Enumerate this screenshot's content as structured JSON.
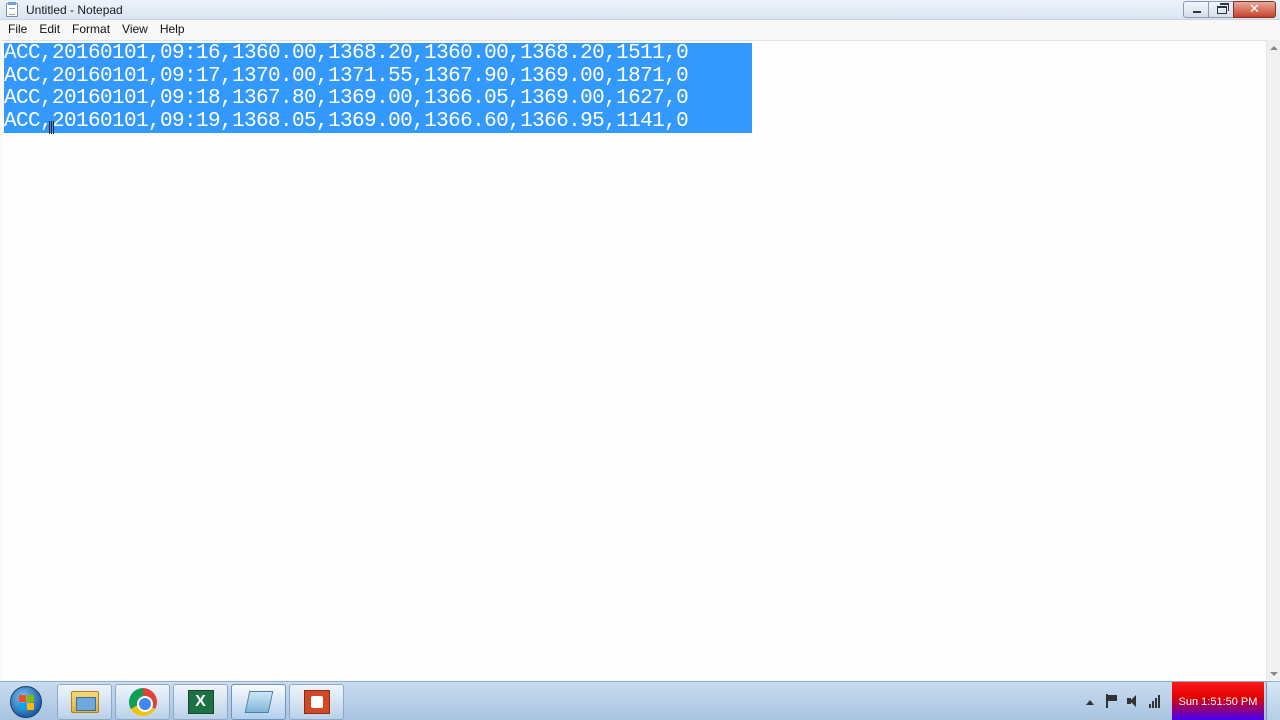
{
  "window": {
    "title": "Untitled - Notepad",
    "icon": "notepad-icon"
  },
  "menu": {
    "items": [
      "File",
      "Edit",
      "Format",
      "View",
      "Help"
    ]
  },
  "editor": {
    "lines": [
      "ACC,20160101,09:16,1360.00,1368.20,1360.00,1368.20,1511,0",
      "ACC,20160101,09:17,1370.00,1371.55,1367.90,1369.00,1871,0",
      "ACC,20160101,09:18,1367.80,1369.00,1366.05,1369.00,1627,0",
      "ACC,20160101,09:19,1368.05,1369.00,1366.60,1366.95,1141,0"
    ],
    "selection": "all",
    "selection_color": "#3399ff"
  },
  "taskbar": {
    "start": "windows-start-orb",
    "pinned": [
      "windows-explorer-icon",
      "chrome-icon",
      "excel-icon",
      "notepad-icon",
      "powerpoint-icon"
    ],
    "clock": "Sun 1:51:50 PM",
    "tray_icons": [
      "show-hidden-icons",
      "action-center-flag-icon",
      "volume-icon",
      "network-signal-icon"
    ]
  }
}
